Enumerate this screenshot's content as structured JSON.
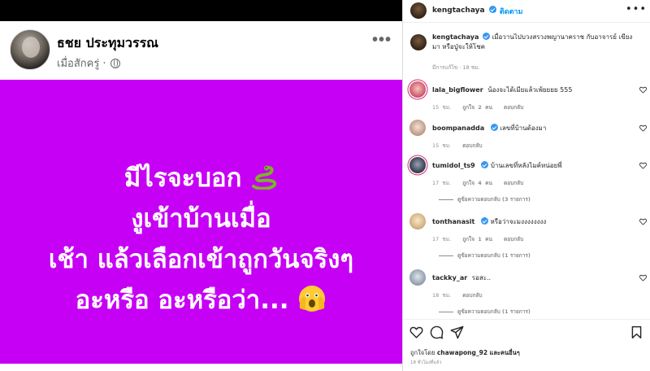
{
  "post": {
    "author": "ธชย ประทุมวรรณ",
    "meta": "เมื่อสักครู่ ·",
    "lines": [
      "มีไรจะบอก",
      "งูเข้าบ้านเมื่อ",
      "เช้า แล้วเลือกเข้าถูกวันจริงๆ",
      "อะหรือ อะหรือว่า..."
    ],
    "colors": {
      "background": "#c600f4",
      "text": "#ffffff"
    }
  },
  "instagram": {
    "header": {
      "username": "kengtachaya",
      "follow": "• ติดตาม"
    },
    "caption": {
      "username": "kengtachaya",
      "text": "เมื่อวานไปบวงสรวงพญานาคราช กับอาจารย์ เขียงมา หรือปู่จะให้โชค",
      "time": "มีการแก้ไข · 18 ชม."
    },
    "comments": [
      {
        "user": "lala_bigflower",
        "text": "น้องจะได้เมียแล้วเพ้ยยยย 555",
        "time": "15 ชม.",
        "likes": "ถูกใจ 2 คน",
        "reply": "ตอบกลับ"
      },
      {
        "user": "boompanadda",
        "text": "เลขที่บ้านต้องมา",
        "time": "15 ชม.",
        "likes": "",
        "reply": "ตอบกลับ"
      },
      {
        "user": "tumidol_ts9",
        "text": "บ้านเลขที่หลังไมค์หน่อยพี่",
        "time": "17 ชม.",
        "likes": "ถูกใจ 4 คน",
        "reply": "ตอบกลับ",
        "view_replies": "ดูข้อความตอบกลับ (3 รายการ)"
      },
      {
        "user": "tonthanasit",
        "text": "หรือว่าจะมงงงงงงงง",
        "time": "17 ชม.",
        "likes": "ถูกใจ 1 คน",
        "reply": "ตอบกลับ",
        "view_replies": "ดูข้อความตอบกลับ (1 รายการ)"
      },
      {
        "user": "tackky_ar",
        "text": "รอสะ..",
        "time": "18 ชม.",
        "likes": "",
        "reply": "ตอบกลับ",
        "view_replies": "ดูข้อความตอบกลับ (1 รายการ)"
      }
    ],
    "footer": {
      "liked_by_prefix": "ถูกใจโดย",
      "liked_by_user": "chawapong_92",
      "liked_by_suffix": "และคนอื่นๆ",
      "age": "18 ชั่วโมงที่แล้ว"
    },
    "icons": [
      "heart-icon",
      "comment-icon",
      "share-icon",
      "bookmark-icon",
      "verified-icon",
      "more-icon"
    ]
  }
}
